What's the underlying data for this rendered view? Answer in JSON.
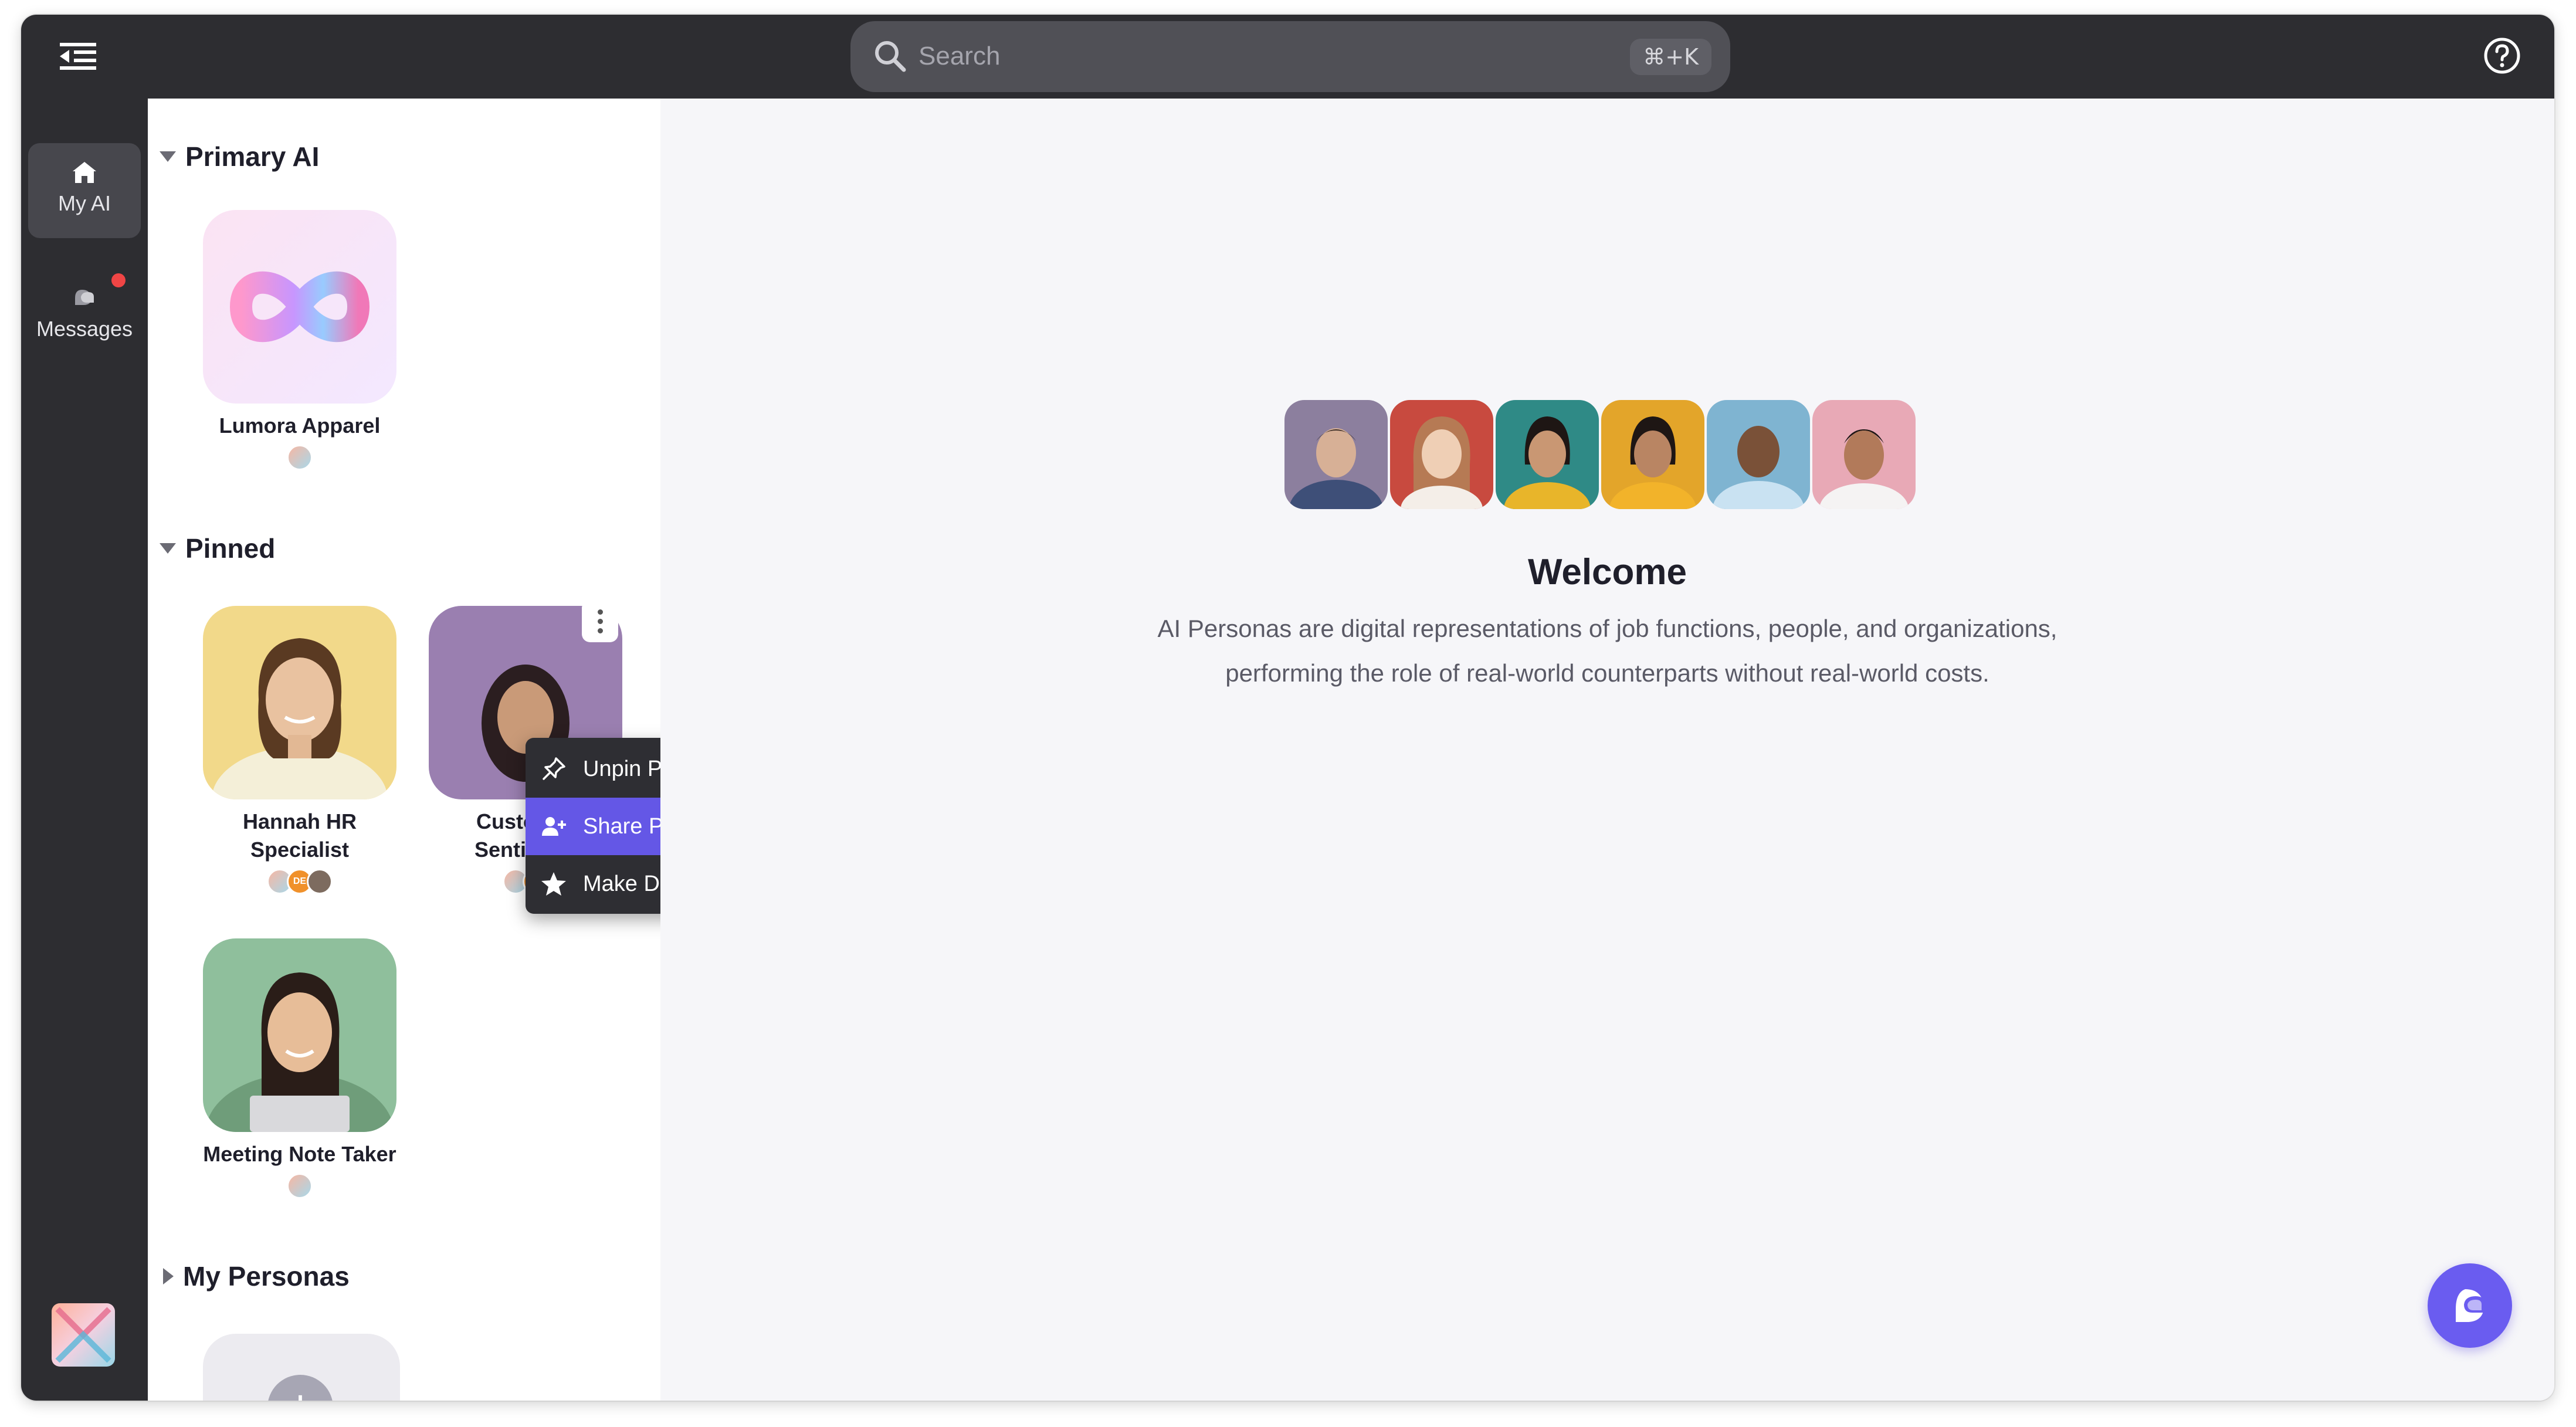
{
  "topbar": {
    "search": {
      "placeholder": "Search",
      "shortcut": "⌘+K"
    }
  },
  "rail": {
    "items": [
      {
        "label": "My AI",
        "icon": "home-icon",
        "active": true
      },
      {
        "label": "Messages",
        "icon": "chat-bubbles-icon",
        "has_notification": true
      }
    ]
  },
  "sidebar": {
    "primary": {
      "title": "Primary AI",
      "cards": [
        {
          "name": "Lumora Apparel"
        }
      ]
    },
    "pinned": {
      "title": "Pinned",
      "cards": [
        {
          "name": "Hannah HR Specialist"
        },
        {
          "name": "Customer Sentiment"
        },
        {
          "name": "Meeting Note Taker"
        }
      ]
    },
    "my_personas": {
      "title": "My Personas",
      "add_label": "+"
    }
  },
  "context_menu": {
    "items": [
      {
        "label": "Unpin Persona",
        "icon": "pin-off-icon"
      },
      {
        "label": "Share Persona",
        "icon": "user-plus-icon",
        "highlighted": true
      },
      {
        "label": "Make Default",
        "icon": "star-icon"
      }
    ]
  },
  "badges": {
    "de": "DE"
  },
  "main": {
    "welcome_title": "Welcome",
    "welcome_line1": "AI Personas are digital representations of job functions, people, and organizations,",
    "welcome_line2": "performing the role of real-world counterparts without real-world costs."
  },
  "colors": {
    "topbar_bg": "#2d2d31",
    "accent": "#6457e6",
    "notification": "#f04545",
    "main_bg": "#f6f6f9"
  }
}
